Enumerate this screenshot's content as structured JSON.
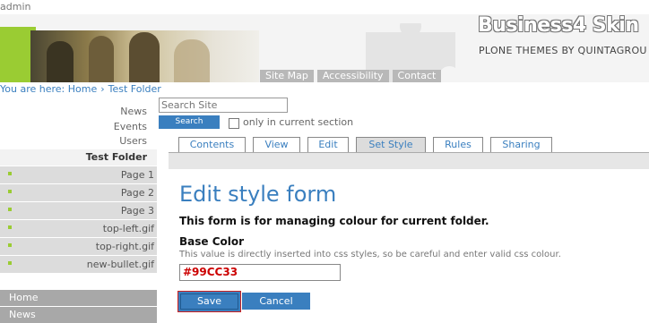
{
  "user": "admin",
  "header": {
    "brand": "Business4 Skin",
    "tagline": "PLONE THEMES BY QUINTAGROU",
    "site_actions": [
      "Site Map",
      "Accessibility",
      "Contact"
    ]
  },
  "breadcrumb": {
    "prefix": "You are here:",
    "items": [
      "Home",
      "Test Folder"
    ],
    "separator": "›"
  },
  "nav": {
    "top_items": [
      "News",
      "Events",
      "Users"
    ],
    "current": "Test Folder",
    "sub_items": [
      "Page 1",
      "Page 2",
      "Page 3",
      "top-left.gif",
      "top-right.gif",
      "new-bullet.gif"
    ],
    "bottom_items": [
      "Home",
      "News"
    ]
  },
  "search": {
    "placeholder": "Search Site",
    "button": "Search",
    "option_label": "only in current section"
  },
  "tabs": {
    "items": [
      "Contents",
      "View",
      "Edit",
      "Set Style",
      "Rules",
      "Sharing"
    ],
    "active": "Set Style"
  },
  "form": {
    "title": "Edit style form",
    "description": "This form is for managing colour for current folder.",
    "field_label": "Base Color",
    "field_help": "This value is directly inserted into css styles, so be careful and enter valid css colour.",
    "field_value": "#99CC33",
    "save_label": "Save",
    "cancel_label": "Cancel"
  },
  "colors": {
    "accent": "#3a7fbf",
    "brand_green": "#9acc33",
    "value_red": "#cc0000"
  }
}
